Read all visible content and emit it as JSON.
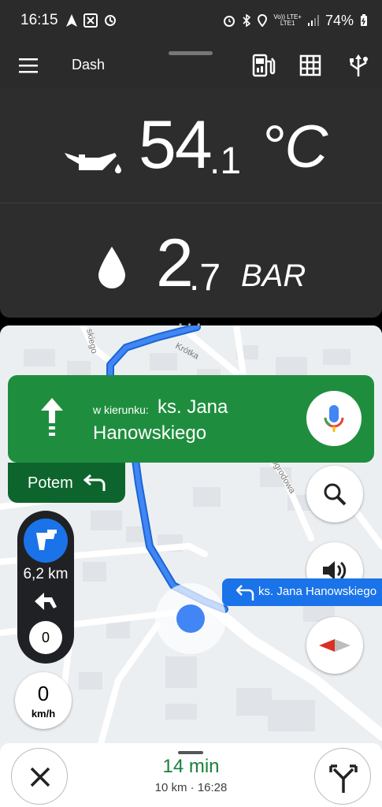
{
  "status_bar": {
    "time": "16:15",
    "network_top": "Vo))",
    "network_bottom": "LTE1",
    "lte_label": "LTE+",
    "battery_percent": "74%",
    "icons": [
      "navigation-icon",
      "screen-icon",
      "app-icon",
      "alarm-icon",
      "bluetooth-icon",
      "location-icon",
      "signal-icon",
      "battery-icon"
    ]
  },
  "header": {
    "title": "Dash",
    "icons": [
      "menu-icon",
      "fuel-pump-icon",
      "grid-icon",
      "usb-icon"
    ]
  },
  "gauges": [
    {
      "icon": "oil-can-icon",
      "value_int": "54",
      "value_dec": ".1",
      "unit": "°C"
    },
    {
      "icon": "droplet-icon",
      "value_int": "2",
      "value_dec": ".7",
      "unit": "BAR"
    }
  ],
  "map": {
    "street_labels": [
      "Krótka",
      "ogrodowa",
      "skiego"
    ]
  },
  "navigation": {
    "toward_label": "w kierunku:",
    "street_line1": "ks. Jana",
    "street_line2": "Hanowskiego",
    "then_label": "Potem",
    "distance": "6,2 km",
    "zero_count": "0",
    "speed": "0",
    "speed_unit": "km/h",
    "street_chip": "ks. Jana Hanowskiego"
  },
  "trip": {
    "eta_time": "14 min",
    "distance": "10 km",
    "separator": "·",
    "arrival": "16:28"
  },
  "colors": {
    "nav_green": "#1e8e3e",
    "nav_dark_green": "#0d652d",
    "route_blue": "#1a73e8",
    "eta_green": "#188038",
    "panel_dark": "#2d2d2d"
  }
}
